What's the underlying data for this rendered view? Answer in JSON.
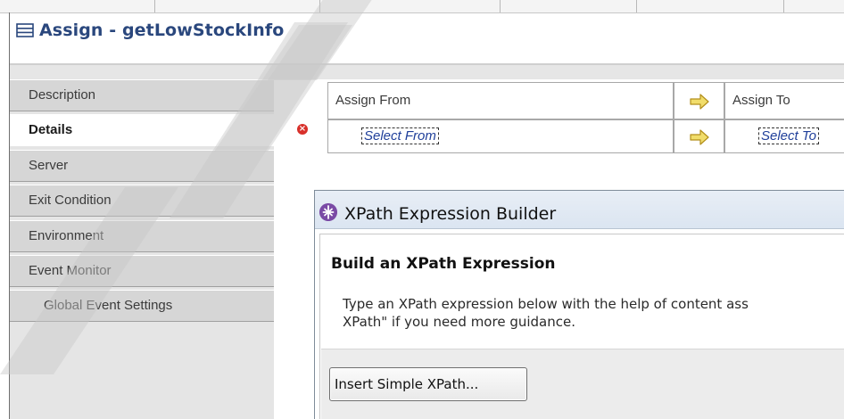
{
  "header": {
    "title": "Assign - getLowStockInfo",
    "icon": "list-icon"
  },
  "sidebar": {
    "items": [
      {
        "label": "Description",
        "active": false
      },
      {
        "label": "Details",
        "active": true
      },
      {
        "label": "Server",
        "active": false
      },
      {
        "label": "Exit Condition",
        "active": false
      },
      {
        "label": "Environment",
        "active": false
      },
      {
        "label": "Event Monitor",
        "active": false
      },
      {
        "label": "Global Event Settings",
        "active": false,
        "sub": true
      }
    ]
  },
  "assign_table": {
    "from_header": "Assign From",
    "to_header": "Assign To",
    "from_link": "Select From",
    "to_link": "Select To",
    "arrow_icon": "right-arrow-icon",
    "arrow_color": "#e6c84a"
  },
  "dialog": {
    "title": "XPath Expression Builder",
    "heading": "Build an XPath Expression",
    "description_line1": "Type an XPath expression below with the help of content ass",
    "description_line2": "XPath\" if you need more guidance.",
    "button": "Insert Simple XPath..."
  },
  "colors": {
    "title": "#2a477d",
    "error": "#d8302a",
    "link": "#1f3f9a"
  }
}
